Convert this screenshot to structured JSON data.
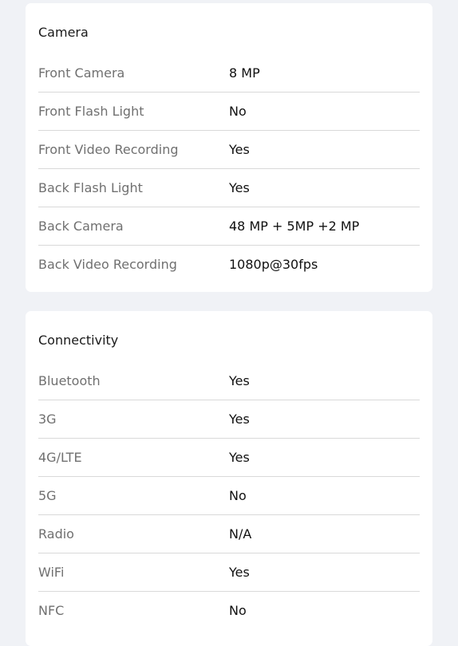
{
  "sections": [
    {
      "title": "Camera",
      "rows": [
        {
          "label": "Front Camera",
          "value": "8 MP"
        },
        {
          "label": "Front Flash Light",
          "value": "No"
        },
        {
          "label": "Front Video Recording",
          "value": "Yes"
        },
        {
          "label": "Back Flash Light",
          "value": "Yes"
        },
        {
          "label": "Back Camera",
          "value": "48 MP + 5MP +2 MP"
        },
        {
          "label": "Back Video Recording",
          "value": "1080p@30fps"
        }
      ]
    },
    {
      "title": "Connectivity",
      "rows": [
        {
          "label": "Bluetooth",
          "value": "Yes"
        },
        {
          "label": "3G",
          "value": "Yes"
        },
        {
          "label": "4G/LTE",
          "value": "Yes"
        },
        {
          "label": "5G",
          "value": "No"
        },
        {
          "label": "Radio",
          "value": "N/A"
        },
        {
          "label": "WiFi",
          "value": "Yes"
        },
        {
          "label": "NFC",
          "value": "No"
        }
      ]
    }
  ]
}
